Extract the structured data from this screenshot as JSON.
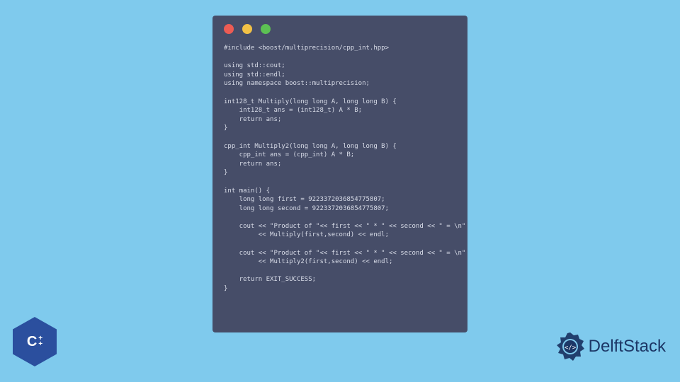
{
  "code": {
    "line1": "#include <boost/multiprecision/cpp_int.hpp>",
    "line2": "",
    "line3": "using std::cout;",
    "line4": "using std::endl;",
    "line5": "using namespace boost::multiprecision;",
    "line6": "",
    "line7": "int128_t Multiply(long long A, long long B) {",
    "line8": "    int128_t ans = (int128_t) A * B;",
    "line9": "    return ans;",
    "line10": "}",
    "line11": "",
    "line12": "cpp_int Multiply2(long long A, long long B) {",
    "line13": "    cpp_int ans = (cpp_int) A * B;",
    "line14": "    return ans;",
    "line15": "}",
    "line16": "",
    "line17": "int main() {",
    "line18": "    long long first = 9223372036854775807;",
    "line19": "    long long second = 9223372036854775807;",
    "line20": "",
    "line21": "    cout << \"Product of \"<< first << \" * \" << second << \" = \\n\"",
    "line22": "         << Multiply(first,second) << endl;",
    "line23": "",
    "line24": "    cout << \"Product of \"<< first << \" * \" << second << \" = \\n\"",
    "line25": "         << Multiply2(first,second) << endl;",
    "line26": "",
    "line27": "    return EXIT_SUCCESS;",
    "line28": "}"
  },
  "cpp_badge": {
    "letter": "C",
    "plus1": "+",
    "plus2": "+"
  },
  "brand": {
    "name": "DelftStack"
  },
  "colors": {
    "bg": "#7fcaed",
    "window": "#464d68",
    "code_text": "#d8dce8",
    "dot_red": "#ec5c54",
    "dot_yellow": "#f2c146",
    "dot_green": "#5cc153",
    "cpp_blue": "#2b4f9e",
    "brand_blue": "#1c3766"
  }
}
